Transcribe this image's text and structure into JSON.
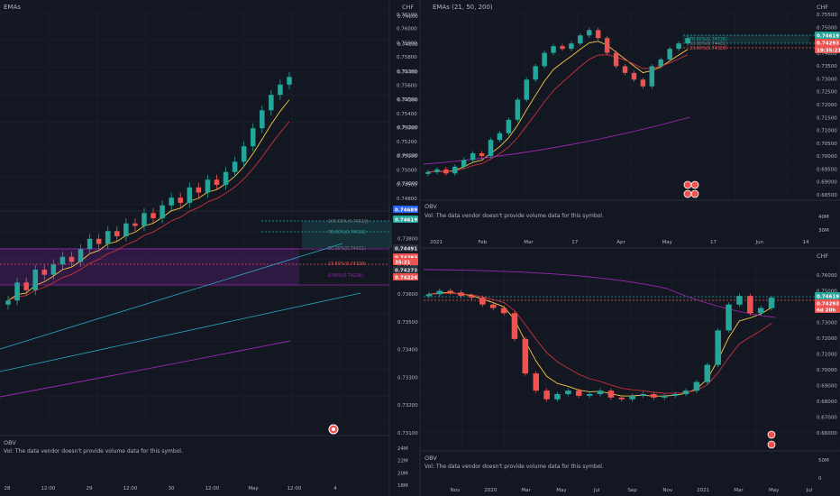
{
  "colors": {
    "background": "#131722",
    "grid": "#1e222d",
    "separator": "#2a2e39",
    "up": "#26a69a",
    "down": "#ef5350",
    "ema21": "#f7c948",
    "ema50": "#c8323c",
    "ema200": "#9c27b0",
    "channel": "#2aa8c4",
    "text": "#b2b5be",
    "current_price_bg": "#26a69a",
    "blue_label": "#2962ff"
  },
  "panels": {
    "left": {
      "indicator_label": "EMAs",
      "currency": "CHF",
      "price_ticks": [
        "0.74600",
        "0.74500",
        "0.74400",
        "0.74300",
        "0.74200",
        "0.74100",
        "0.74000",
        "0.73900",
        "0.73800",
        "0.73700",
        "0.73600",
        "0.73500",
        "0.73400",
        "0.73300",
        "0.73200",
        "0.73100"
      ],
      "price_labels": [
        {
          "text": "0.74689",
          "role": "blue"
        },
        {
          "text": "0.74619",
          "role": "teal"
        },
        {
          "text": "0.74491",
          "role": "plain"
        },
        {
          "text": "0.74293",
          "role": "red"
        },
        {
          "text": "35:21",
          "role": "red"
        },
        {
          "text": "0.74273",
          "role": "plain"
        },
        {
          "text": "0.74224",
          "role": "red"
        }
      ],
      "fib_labels": [
        "100.00%(0.74619)",
        "78.60%(0.74536)",
        "50.00%(0.74431)",
        "23.60%(0.74329)",
        "0.00%(0.74224)"
      ],
      "time_ticks": [
        "28",
        "12:00",
        "29",
        "12:00",
        "30",
        "12:00",
        "May",
        "12:00",
        "4"
      ],
      "obv_title": "OBV",
      "obv_note": "Vol: The data vendor doesn't provide volume data for this symbol.",
      "obv_axis": [
        "24M",
        "22M",
        "20M",
        "18M"
      ]
    },
    "top_right": {
      "indicator_label": "EMAs (21, 50, 200)",
      "currency": "CHF",
      "price_ticks": [
        "0.76100",
        "0.76000",
        "0.75900",
        "0.75800",
        "0.75700",
        "0.75600",
        "0.75500",
        "0.75400",
        "0.75300",
        "0.75200",
        "0.75100",
        "0.75000",
        "0.74900",
        "0.74800"
      ],
      "right_ticks": [
        "0.75500",
        "0.75000",
        "0.74500",
        "0.74000",
        "0.73500",
        "0.73000",
        "0.72500",
        "0.72000",
        "0.71500",
        "0.71000",
        "0.70500",
        "0.70000",
        "0.69500",
        "0.69000",
        "0.68500"
      ],
      "price_labels": [
        {
          "text": "0.74619",
          "role": "teal"
        },
        {
          "text": "0.74293",
          "role": "red"
        },
        {
          "text": "19:35:21",
          "role": "red"
        }
      ],
      "fib_labels": [
        "78.60%(0.74536)",
        "50.00%(0.74431)",
        "23.60%(0.74329)"
      ],
      "time_ticks": [
        "2021",
        "Feb",
        "Mar",
        "17",
        "Apr",
        "May",
        "17",
        "Jun",
        "14"
      ],
      "obv_title": "OBV",
      "obv_note": "Vol: The data vendor doesn't provide volume data for this symbol.",
      "obv_axis": [
        "40M",
        "30M"
      ]
    },
    "bottom_right": {
      "currency": "CHF",
      "price_ticks": [
        "0.76000",
        "0.75000",
        "0.74000",
        "0.73000",
        "0.72000",
        "0.71000",
        "0.70000",
        "0.69000",
        "0.68000",
        "0.67000",
        "0.66000"
      ],
      "price_labels": [
        {
          "text": "0.74619",
          "role": "teal"
        },
        {
          "text": "0.74293",
          "role": "red"
        },
        {
          "text": "6d 20h",
          "role": "red"
        }
      ],
      "time_ticks": [
        "Nov",
        "2020",
        "Mar",
        "May",
        "Jul",
        "Sep",
        "Nov",
        "2021",
        "Mar",
        "May",
        "Jul"
      ],
      "obv_title": "OBV",
      "obv_note": "Vol: The data vendor doesn't provide volume data for this symbol.",
      "obv_axis": [
        "50M",
        "0"
      ]
    }
  },
  "chart_data": [
    {
      "type": "line",
      "title": "EMAs",
      "xlabel": "",
      "ylabel": "CHF",
      "ylim": [
        0.731,
        0.747
      ],
      "series": [
        {
          "name": "price",
          "values": [
            0.7358,
            0.7365,
            0.7362,
            0.737,
            0.7368,
            0.7372,
            0.7375,
            0.7373,
            0.7378,
            0.7382,
            0.738,
            0.7385,
            0.7383,
            0.7388,
            0.7387,
            0.7392,
            0.739,
            0.7395,
            0.7398,
            0.7396,
            0.7402,
            0.74,
            0.7405,
            0.7403,
            0.7408,
            0.7412,
            0.7418,
            0.7425,
            0.7432,
            0.7438,
            0.7442,
            0.7445
          ]
        }
      ]
    },
    {
      "type": "line",
      "title": "EMAs (21, 50, 200)",
      "ylim": [
        0.7475,
        0.7615
      ],
      "series": [
        {
          "name": "price",
          "values": [
            0.7496,
            0.7498,
            0.7495,
            0.75,
            0.7505,
            0.751,
            0.7508,
            0.752,
            0.7525,
            0.7535,
            0.755,
            0.7565,
            0.7575,
            0.7585,
            0.759,
            0.7588,
            0.7592,
            0.7598,
            0.7602,
            0.7596,
            0.7585,
            0.7575,
            0.757,
            0.7565,
            0.756,
            0.7575,
            0.758,
            0.7588,
            0.7592,
            0.7596
          ]
        }
      ]
    },
    {
      "type": "line",
      "ylim": [
        0.655,
        0.765
      ],
      "series": [
        {
          "name": "price",
          "values": [
            0.746,
            0.748,
            0.747,
            0.745,
            0.744,
            0.74,
            0.738,
            0.735,
            0.72,
            0.7,
            0.69,
            0.685,
            0.688,
            0.69,
            0.687,
            0.688,
            0.69,
            0.686,
            0.685,
            0.687,
            0.688,
            0.686,
            0.687,
            0.688,
            0.69,
            0.695,
            0.705,
            0.725,
            0.74,
            0.745,
            0.735,
            0.738,
            0.744
          ]
        }
      ]
    }
  ]
}
